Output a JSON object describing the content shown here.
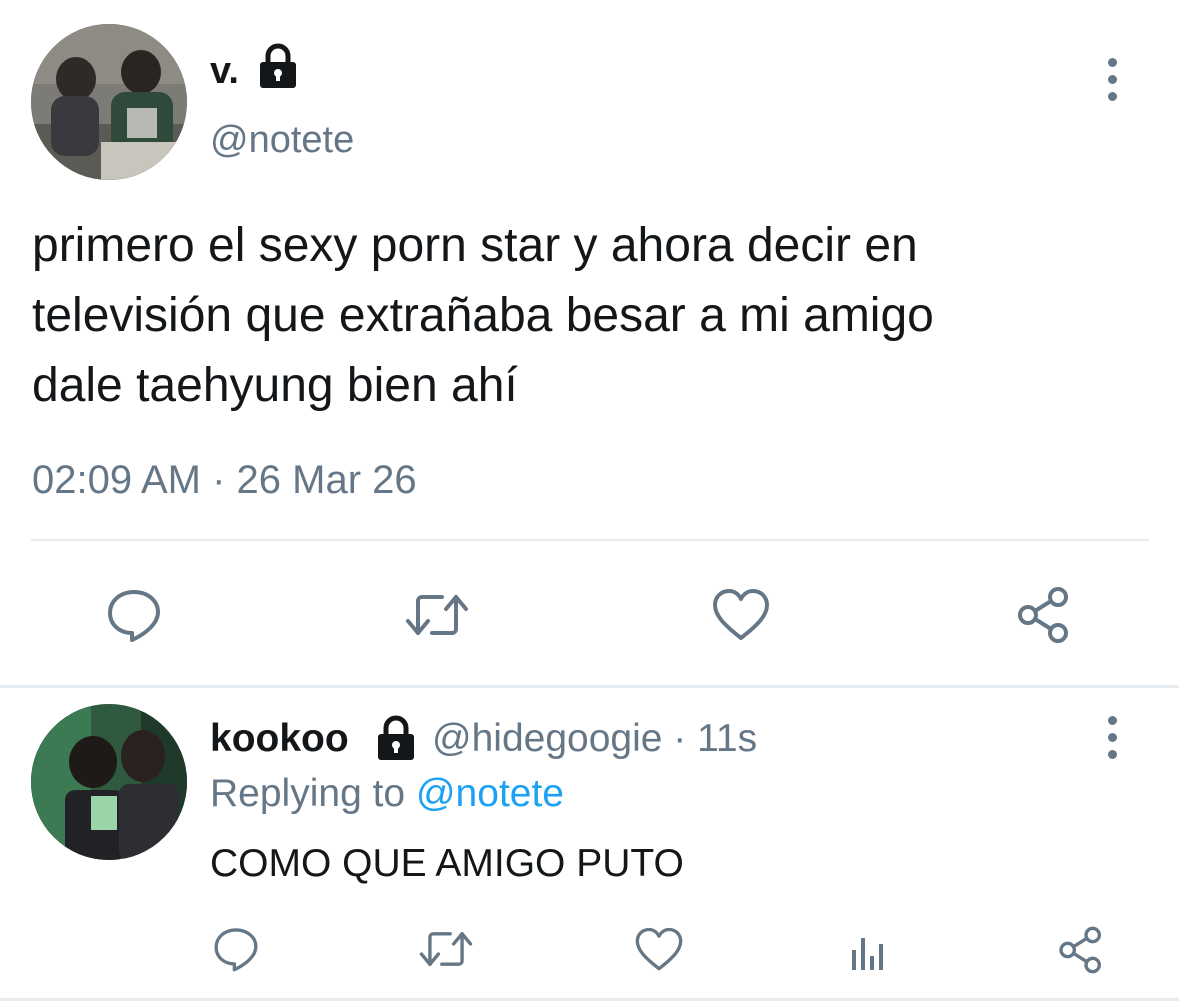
{
  "main_tweet": {
    "display_name": "v.",
    "handle": "@notete",
    "text_lines": [
      "primero el sexy porn star y ahora decir en",
      "televisión que extrañaba besar a mi amigo",
      "dale taehyung bien ahí"
    ],
    "timestamp": "02:09 AM · 26 Mar 26",
    "actions": [
      "reply-icon",
      "retweet-icon",
      "like-icon",
      "share-icon"
    ]
  },
  "reply_tweet": {
    "display_name": "kookoo",
    "handle": "@hidegoogie",
    "separator": "·",
    "time": "11s",
    "replying_prefix": "Replying to",
    "replying_to": "@notete",
    "text": "COMO QUE AMIGO PUTO",
    "actions": [
      "reply-icon",
      "retweet-icon",
      "like-icon",
      "analytics-icon",
      "share-icon"
    ]
  },
  "colors": {
    "text": "#14171a",
    "secondary": "#657786",
    "link": "#1da1f2",
    "divider": "#e6ecf0"
  }
}
